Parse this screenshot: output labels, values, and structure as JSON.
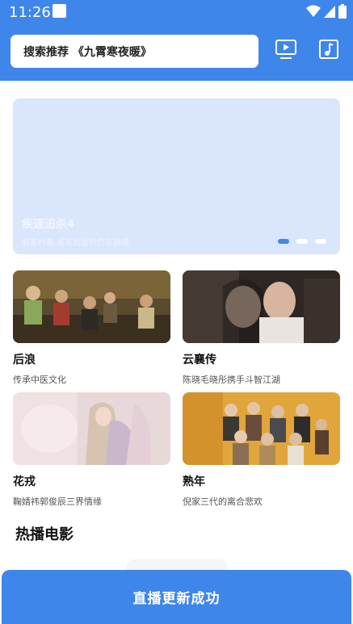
{
  "status_bar": {
    "time": "11:26"
  },
  "header": {
    "search_text": "搜索推荐 《九霄寒夜暖》",
    "icons": [
      "tv-play-icon",
      "music-note-icon"
    ]
  },
  "banner": {
    "title": "疾速追杀4",
    "subtitle": "刺客约翰·威克的冒险仍在继续",
    "slide_count": 3,
    "active_slide": 1
  },
  "cards": [
    {
      "title": "后浪",
      "desc": "传承中医文化"
    },
    {
      "title": "云襄传",
      "desc": "陈晓毛晓彤携手斗智江湖"
    },
    {
      "title": "花戎",
      "desc": "鞠婧祎郭俊辰三界情缘"
    },
    {
      "title": "熟年",
      "desc": "倪家三代的离合悲欢"
    }
  ],
  "section": {
    "title": "热播电影"
  },
  "toast": {
    "label": "直播更新成功"
  },
  "colors": {
    "primary": "#3f86ea",
    "banner_bg": "#d9e6fc"
  }
}
